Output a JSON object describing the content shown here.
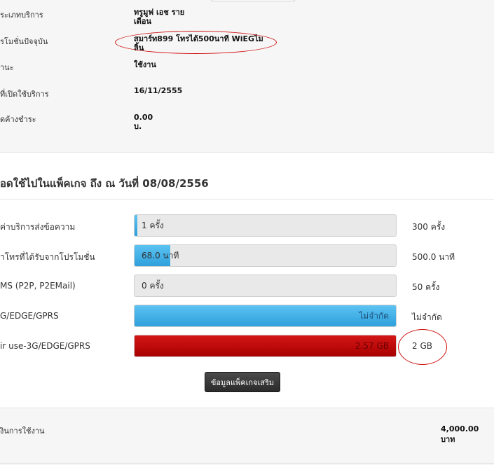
{
  "account_info": [
    {
      "label": "ระเภทบริการ",
      "value_line1": "ทรูมูฟ เอช ราย",
      "value_line2": "เดือน"
    },
    {
      "label": "รโมชั่นปัจจุบัน",
      "value_line1": "สมาร์ท899 โทรได้500นาที WiEGไม",
      "value_line2": "ลิ้น"
    },
    {
      "label": "านะ",
      "value_line1": "ใช้งาน",
      "value_line2": ""
    },
    {
      "label": "ที่เปิดใช้บริการ",
      "value_line1": "16/11/2555",
      "value_line2": ""
    },
    {
      "label": "ดค้างชำระ",
      "value_line1": "0.00",
      "value_line2": "บ."
    }
  ],
  "usage": {
    "title": "อดใช้ไปในแพ็คเกจ ถึง ณ วันที่ 08/08/2556",
    "rows": [
      {
        "label": "ค่าบริการส่งข้อความ",
        "bar_text": "1 ครั้ง",
        "limit": "300 ครั้ง",
        "fill_fraction": 0.0033,
        "color": "blue",
        "text_align": "left"
      },
      {
        "label": "าโทรที่ได้รับจากโปรโมชั่น",
        "bar_text": "68.0 นาที",
        "limit": "500.0 นาที",
        "fill_fraction": 0.136,
        "color": "blue",
        "text_align": "left"
      },
      {
        "label": "MS (P2P, P2EMail)",
        "bar_text": "0 ครั้ง",
        "limit": "50 ครั้ง",
        "fill_fraction": 0,
        "color": "blue",
        "text_align": "left"
      },
      {
        "label": "G/EDGE/GPRS",
        "bar_text": "ไม่จำกัด",
        "limit": "ไม่จำกัด",
        "fill_fraction": 1,
        "color": "blue",
        "text_align": "right"
      },
      {
        "label": "ir use-3G/EDGE/GPRS",
        "bar_text": "2.57 GB",
        "limit": "2 GB",
        "fill_fraction": 1,
        "color": "red",
        "text_align": "right"
      }
    ],
    "addon_button_label": "ข้อมูลแพ็คเกจเสริม"
  },
  "billing": {
    "label": "งินการใช้งาน",
    "value_line1": "4,000.00",
    "value_line2": "บาท"
  },
  "colors": {
    "bar_blue": "#2ea0dc",
    "bar_red": "#b80000",
    "annotation_red": "#d01010",
    "panel_bg": "#f6f6f6"
  }
}
